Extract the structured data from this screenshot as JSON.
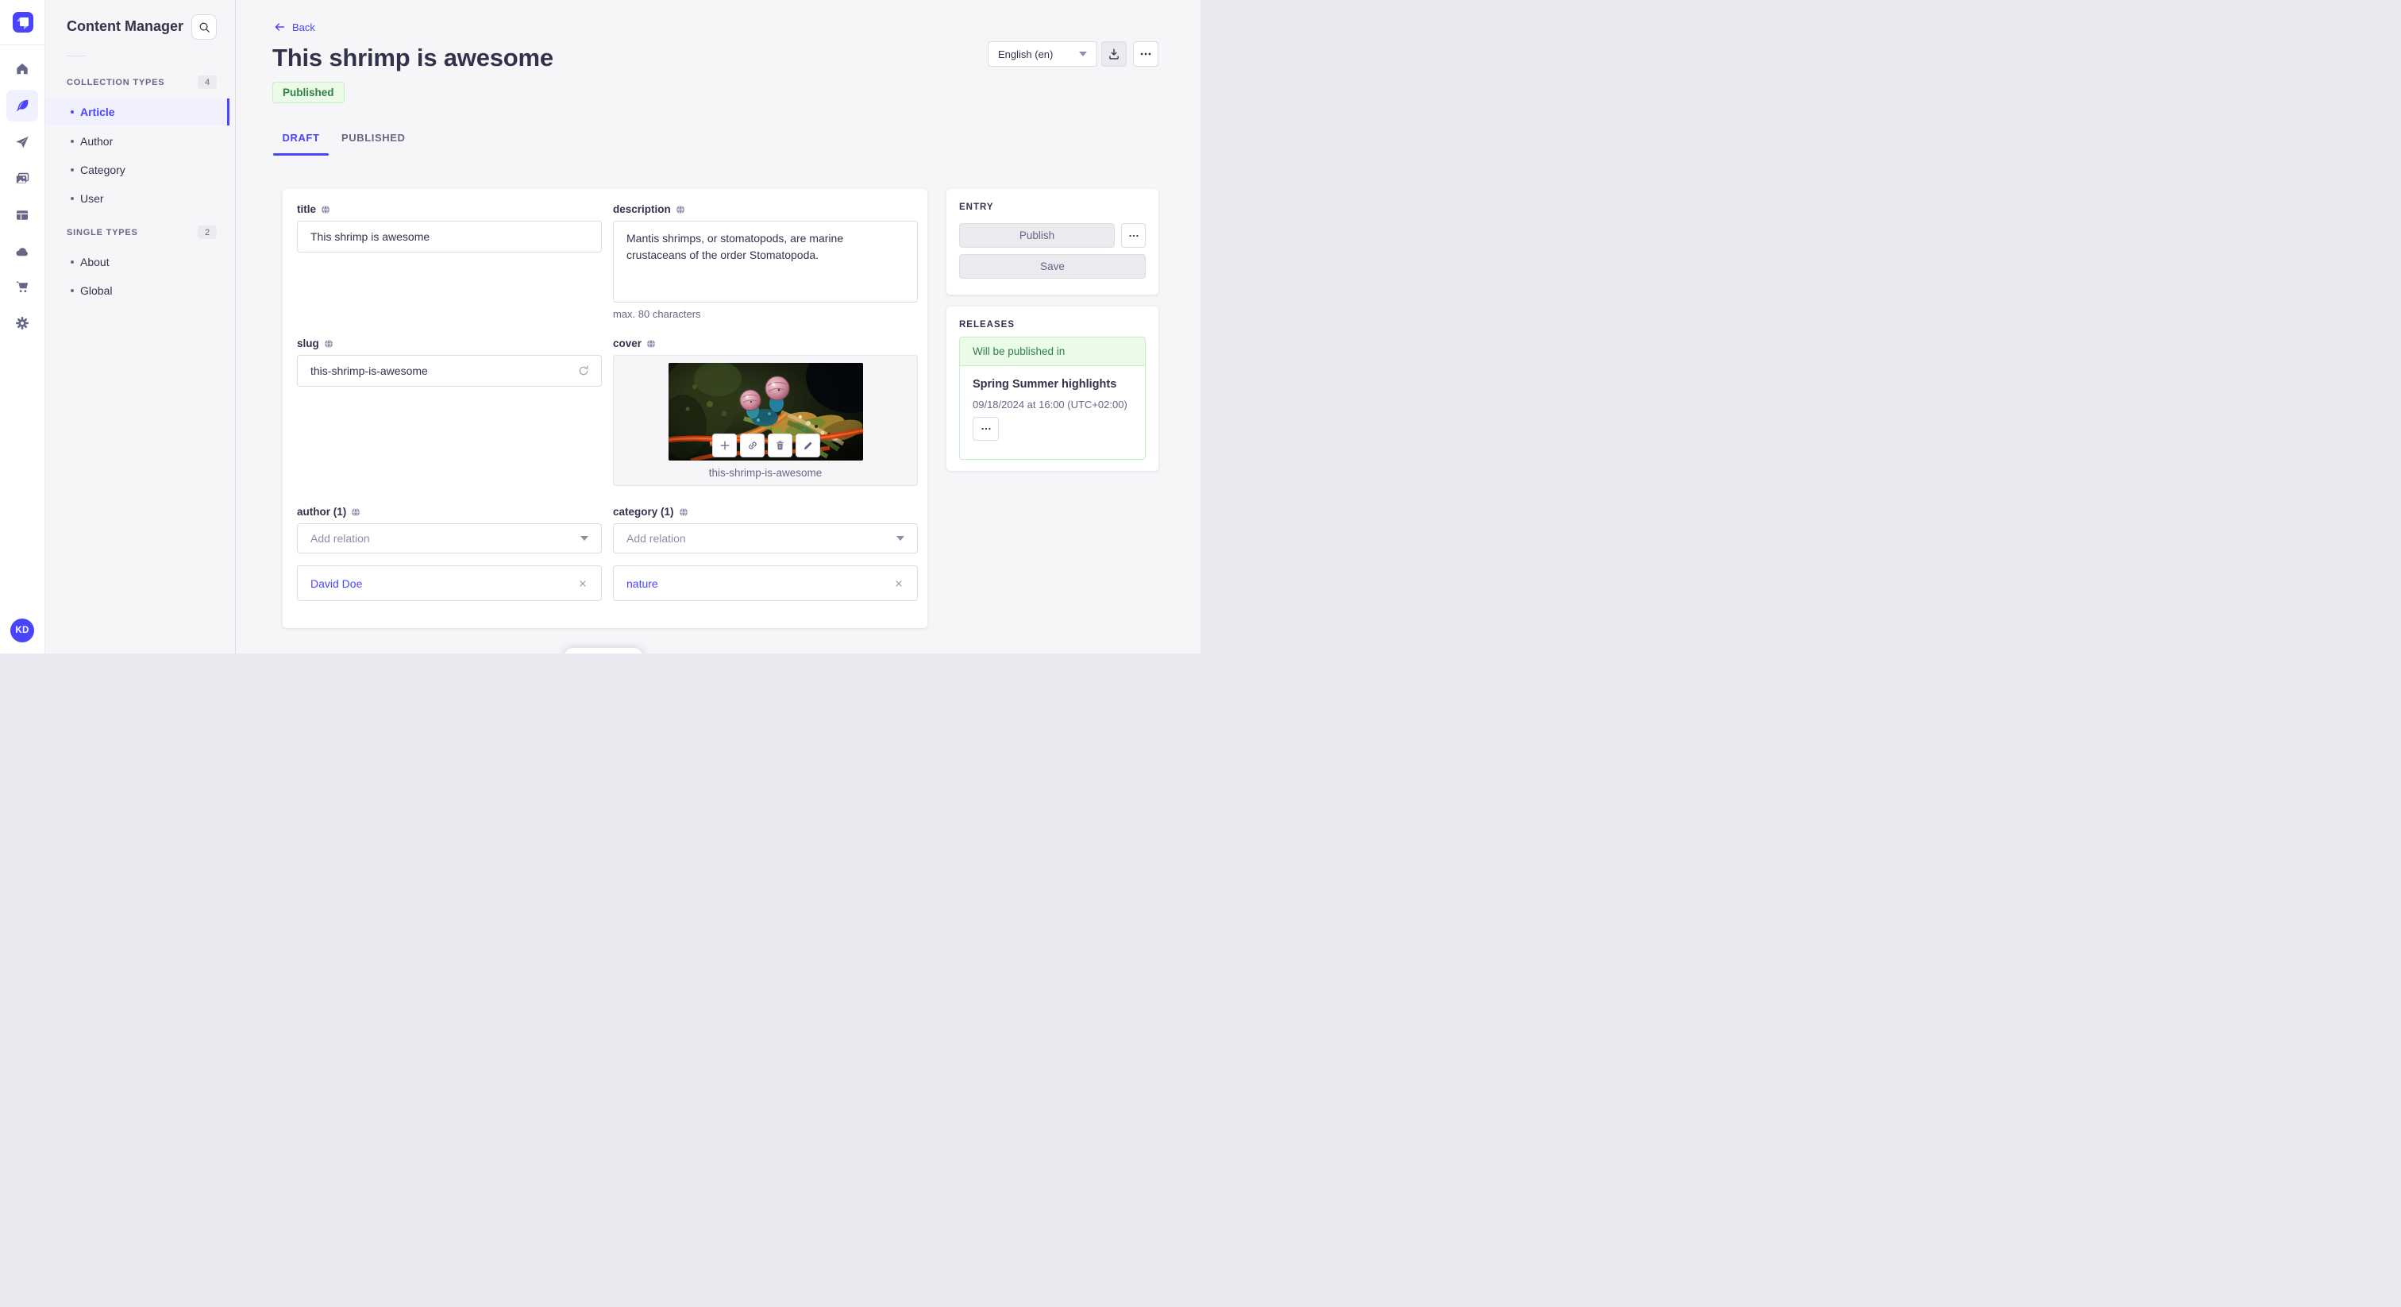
{
  "colors": {
    "accent": "#4945ff",
    "accent_bg": "#f0f0ff",
    "success_text": "#328048",
    "success_bg": "#eafbe7",
    "success_border": "#c6f0c2",
    "page_bg": "#f6f6f9",
    "border": "#dcdce4",
    "text": "#32324d",
    "text_muted": "#666687"
  },
  "rail": {
    "icons": [
      "home-icon",
      "content-manager-feather-icon",
      "send-plane-icon",
      "media-library-icon",
      "content-type-builder-icon",
      "cloud-icon",
      "marketplace-cart-icon",
      "settings-gear-icon"
    ],
    "active_icon": "content-manager-feather-icon",
    "avatar_initials": "KD"
  },
  "sidebar": {
    "title": "Content Manager",
    "search_icon": "magnifier",
    "sections": [
      {
        "label": "COLLECTION TYPES",
        "count": "4",
        "items": [
          {
            "label": "Article",
            "active": true
          },
          {
            "label": "Author",
            "active": false
          },
          {
            "label": "Category",
            "active": false
          },
          {
            "label": "User",
            "active": false
          }
        ]
      },
      {
        "label": "SINGLE TYPES",
        "count": "2",
        "items": [
          {
            "label": "About",
            "active": false
          },
          {
            "label": "Global",
            "active": false
          }
        ]
      }
    ]
  },
  "header": {
    "back_label": "Back",
    "title": "This shrimp is awesome",
    "status_badge": "Published",
    "locale_selector": "English (en)"
  },
  "tabs": [
    {
      "label": "DRAFT",
      "active": true
    },
    {
      "label": "PUBLISHED",
      "active": false
    }
  ],
  "form": {
    "title": {
      "label": "title",
      "value": "This shrimp is awesome"
    },
    "description": {
      "label": "description",
      "value": "Mantis shrimps, or stomatopods, are marine crustaceans of the order Stomatopoda.",
      "hint": "max. 80 characters"
    },
    "slug": {
      "label": "slug",
      "value": "this-shrimp-is-awesome"
    },
    "cover": {
      "label": "cover",
      "caption": "this-shrimp-is-awesome"
    },
    "author": {
      "label": "author (1)",
      "placeholder": "Add relation",
      "relations": [
        {
          "label": "David Doe"
        }
      ]
    },
    "category": {
      "label": "category (1)",
      "placeholder": "Add relation",
      "relations": [
        {
          "label": "nature"
        }
      ]
    }
  },
  "entry_panel": {
    "heading": "ENTRY",
    "publish_label": "Publish",
    "save_label": "Save"
  },
  "releases_panel": {
    "heading": "RELEASES",
    "status": "Will be published in",
    "release_title": "Spring Summer highlights",
    "release_date": "09/18/2024 at 16:00 (UTC+02:00)"
  }
}
